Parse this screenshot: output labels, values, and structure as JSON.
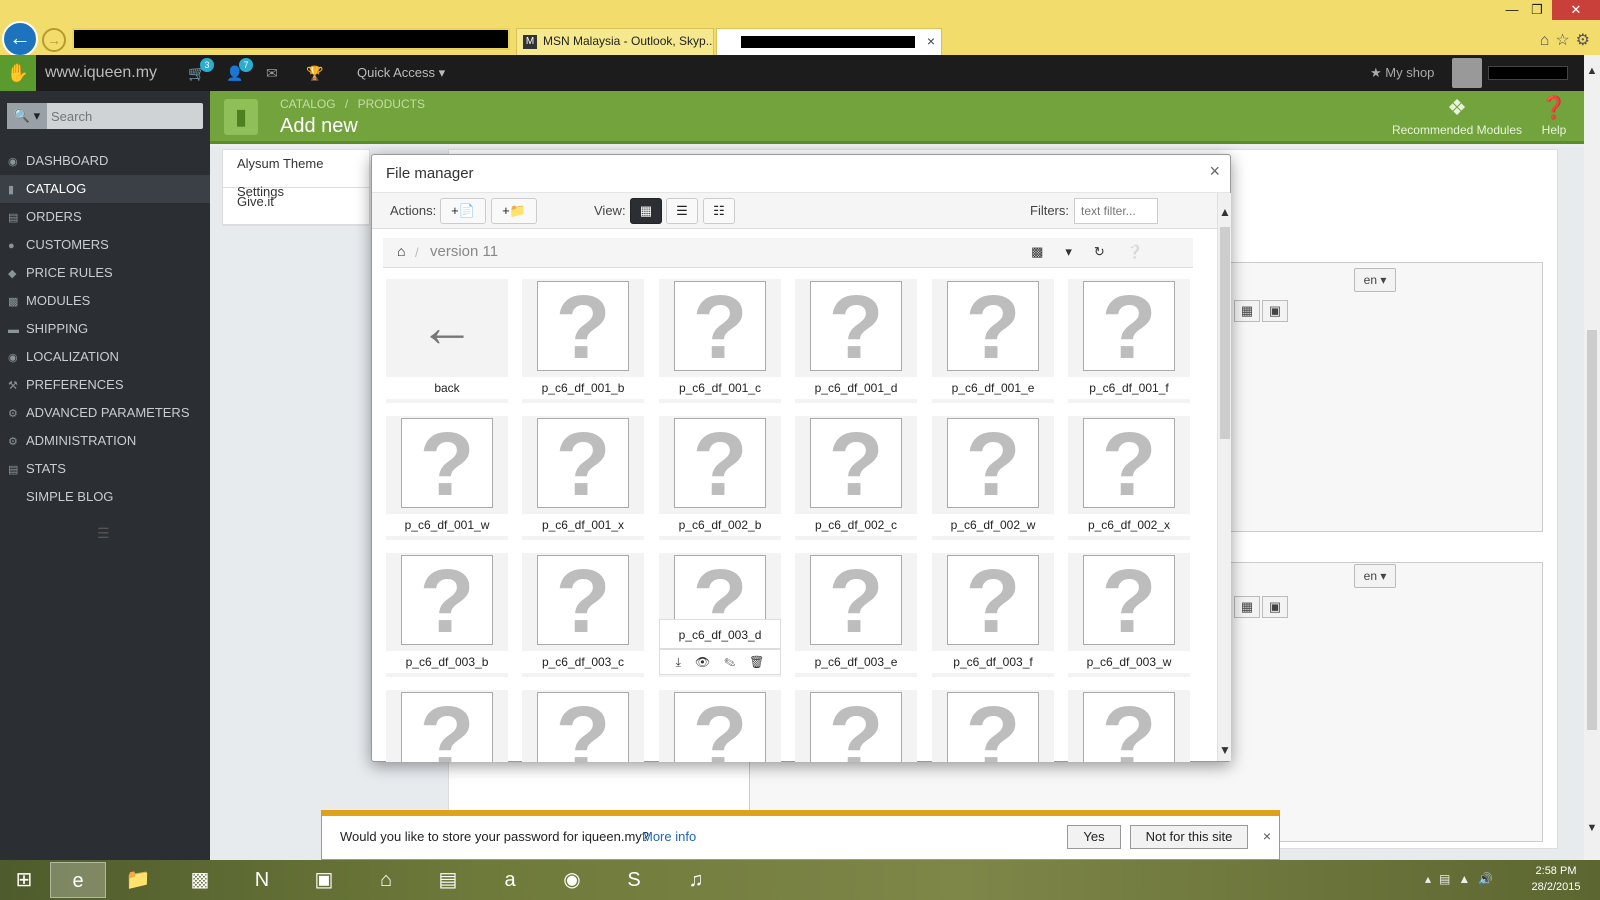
{
  "browser": {
    "tabs": [
      {
        "label": "MSN Malaysia - Outlook, Skyp..."
      },
      {
        "label": ""
      }
    ],
    "close_glyph": "×"
  },
  "header": {
    "site_name": "www.iqueen.my",
    "cart_count": "3",
    "customers_count": "7",
    "quick_access": "Quick Access",
    "my_shop": "My shop"
  },
  "toolbar": {
    "breadcrumb_catalog": "CATALOG",
    "breadcrumb_sep": "/",
    "breadcrumb_products": "PRODUCTS",
    "title": "Add new",
    "recommended": "Recommended Modules",
    "help": "Help"
  },
  "sidebar": {
    "search_placeholder": "Search",
    "items": [
      {
        "label": "DASHBOARD"
      },
      {
        "label": "CATALOG"
      },
      {
        "label": "ORDERS"
      },
      {
        "label": "CUSTOMERS"
      },
      {
        "label": "PRICE RULES"
      },
      {
        "label": "MODULES"
      },
      {
        "label": "SHIPPING"
      },
      {
        "label": "LOCALIZATION"
      },
      {
        "label": "PREFERENCES"
      },
      {
        "label": "ADVANCED PARAMETERS"
      },
      {
        "label": "ADMINISTRATION"
      },
      {
        "label": "STATS"
      },
      {
        "label": "SIMPLE BLOG"
      }
    ]
  },
  "background": {
    "left_links": [
      "Alysum Theme Settings",
      "Give.it"
    ],
    "lang_label": "en"
  },
  "file_manager": {
    "title": "File manager",
    "actions_label": "Actions:",
    "view_label": "View:",
    "filters_label": "Filters:",
    "filter_placeholder": "text filter...",
    "folder": "version 11",
    "placeholder_glyph": "?",
    "items": [
      "back",
      "p_c6_df_001_b",
      "p_c6_df_001_c",
      "p_c6_df_001_d",
      "p_c6_df_001_e",
      "p_c6_df_001_f",
      "p_c6_df_001_w",
      "p_c6_df_001_x",
      "p_c6_df_002_b",
      "p_c6_df_002_c",
      "p_c6_df_002_w",
      "p_c6_df_002_x",
      "p_c6_df_003_b",
      "p_c6_df_003_c",
      "p_c6_df_003_d",
      "p_c6_df_003_e",
      "p_c6_df_003_f",
      "p_c6_df_003_w"
    ]
  },
  "password_bar": {
    "message": "Would you like to store your password for iqueen.my?",
    "more_info": "More info",
    "yes": "Yes",
    "not_for_site": "Not for this site"
  },
  "taskbar": {
    "time": "2:58 PM",
    "date": "28/2/2015"
  },
  "colors": {
    "accent_green": "#72a33d",
    "sidebar_dark": "#2b2f33",
    "browser_yellow": "#f2dc6b"
  }
}
